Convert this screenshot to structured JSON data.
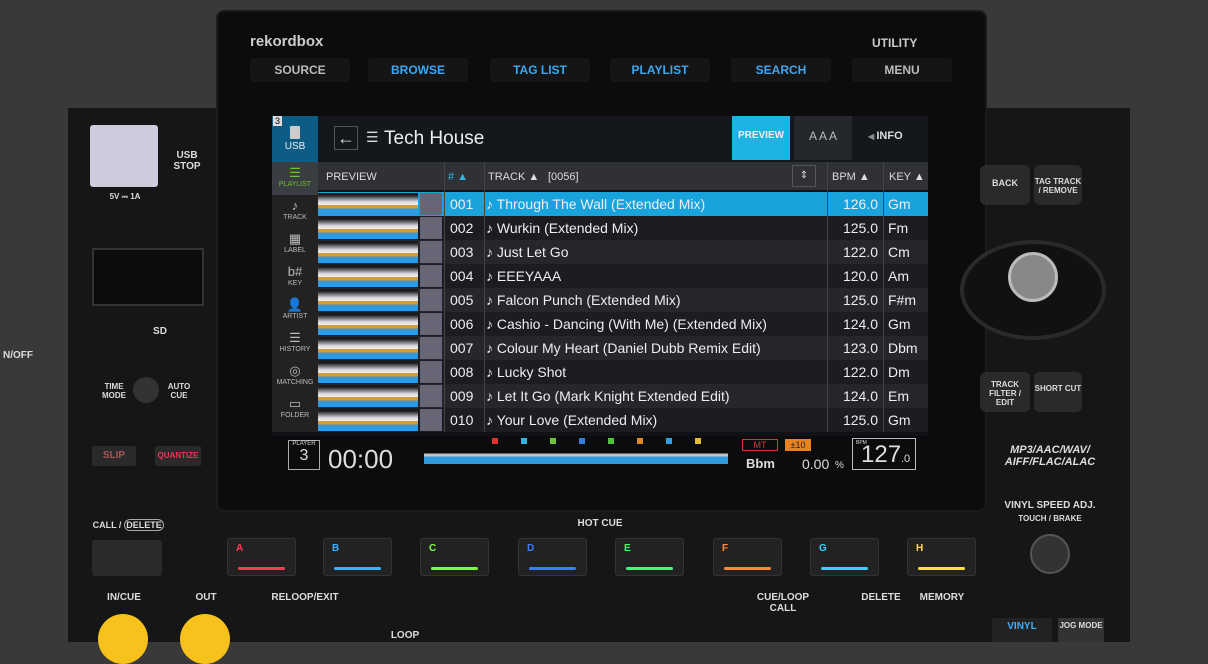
{
  "brand": "rekordbox",
  "utility": "UTILITY",
  "top_buttons": [
    {
      "label": "SOURCE",
      "active": false
    },
    {
      "label": "BROWSE",
      "active": true
    },
    {
      "label": "TAG LIST",
      "active": true
    },
    {
      "label": "PLAYLIST",
      "active": true
    },
    {
      "label": "SEARCH",
      "active": true
    },
    {
      "label": "MENU",
      "active": false
    }
  ],
  "screen": {
    "player_badge": "3",
    "source": "USB",
    "back_icon": "arrow-left-icon",
    "title": "Tech House",
    "preview_button": "PREVIEW",
    "font_size_button": "A A A",
    "info_button": "INFO",
    "sidebar": [
      {
        "label": "PLAYLIST",
        "icon": "list-icon",
        "active": true
      },
      {
        "label": "TRACK",
        "icon": "note-icon"
      },
      {
        "label": "LABEL",
        "icon": "grid-icon"
      },
      {
        "label": "KEY",
        "icon": "key-icon"
      },
      {
        "label": "ARTIST",
        "icon": "person-icon"
      },
      {
        "label": "HISTORY",
        "icon": "history-icon"
      },
      {
        "label": "MATCHING",
        "icon": "matching-icon"
      },
      {
        "label": "FOLDER",
        "icon": "folder-icon"
      }
    ],
    "columns": {
      "preview": "PREVIEW",
      "num": "# ▲",
      "track": "TRACK ▲",
      "count": "[0056]",
      "bpm": "BPM ▲",
      "key": "KEY ▲"
    },
    "rows": [
      {
        "num": "001",
        "track": "Through The Wall (Extended Mix)",
        "bpm": "126.0",
        "key": "Gm",
        "selected": true
      },
      {
        "num": "002",
        "track": "Wurkin (Extended Mix)",
        "bpm": "125.0",
        "key": "Fm"
      },
      {
        "num": "003",
        "track": "Just Let Go",
        "bpm": "122.0",
        "key": "Cm"
      },
      {
        "num": "004",
        "track": "EEEYAAA",
        "bpm": "120.0",
        "key": "Am"
      },
      {
        "num": "005",
        "track": "Falcon Punch (Extended Mix)",
        "bpm": "125.0",
        "key": "F#m"
      },
      {
        "num": "006",
        "track": "Cashio - Dancing (With Me) (Extended Mix)",
        "bpm": "124.0",
        "key": "Gm"
      },
      {
        "num": "007",
        "track": "Colour My Heart (Daniel Dubb Remix Edit)",
        "bpm": "123.0",
        "key": "Dbm"
      },
      {
        "num": "008",
        "track": "Lucky Shot",
        "bpm": "122.0",
        "key": "Dm"
      },
      {
        "num": "009",
        "track": "Let It Go (Mark Knight Extended Edit)",
        "bpm": "124.0",
        "key": "Em"
      },
      {
        "num": "010",
        "track": "Your Love (Extended Mix)",
        "bpm": "125.0",
        "key": "Gm"
      }
    ],
    "footer": {
      "player_label": "PLAYER",
      "player_num": "3",
      "time": "00:00",
      "mt": "MT",
      "range": "±10",
      "key": "Bbm",
      "pitch": "0.00",
      "pitch_unit": "%",
      "bpm_label": "BPM",
      "bpm": "127",
      "bpm_dec": ".0",
      "cue_colors": [
        "#e0342c",
        "#2fb5e0",
        "#6ec33a",
        "#2f7fe0",
        "#4ec33a",
        "#e08a2c",
        "#2fa0e0",
        "#e0c02c"
      ]
    }
  },
  "hardware": {
    "usb_stop": "USB STOP",
    "usb_power": "5V ⎓ 1A",
    "sd": "SD",
    "on_off": "N/OFF",
    "time_mode": "TIME MODE",
    "auto_cue": "AUTO CUE",
    "slip": "SLIP",
    "quantize": "QUANTIZE",
    "call": "CALL /",
    "delete_tag": "DELETE",
    "hot_cue": "HOT CUE",
    "in_cue": "IN/CUE",
    "out": "OUT",
    "reloop": "RELOOP/EXIT",
    "loop": "LOOP",
    "cue_loop_call": "CUE/LOOP CALL",
    "delete": "DELETE",
    "memory": "MEMORY",
    "vinyl": "VINYL",
    "jog_mode": "JOG MODE",
    "back": "BACK",
    "tag_track": "TAG TRACK / REMOVE",
    "track_filter": "TRACK FILTER / EDIT",
    "short_cut": "SHORT CUT",
    "formats": "MP3/AAC/WAV/ AIFF/FLAC/ALAC",
    "vinyl_speed": "VINYL SPEED ADJ.",
    "touch_brake": "TOUCH / BRAKE",
    "pads": [
      {
        "label": "A",
        "color": "#ff3a55"
      },
      {
        "label": "B",
        "color": "#3ab0ff"
      },
      {
        "label": "C",
        "color": "#7dff3a"
      },
      {
        "label": "D",
        "color": "#3a7dff"
      },
      {
        "label": "E",
        "color": "#3aff7d"
      },
      {
        "label": "F",
        "color": "#ff8a3a"
      },
      {
        "label": "G",
        "color": "#3ad0ff"
      },
      {
        "label": "H",
        "color": "#ffe03a"
      }
    ]
  }
}
